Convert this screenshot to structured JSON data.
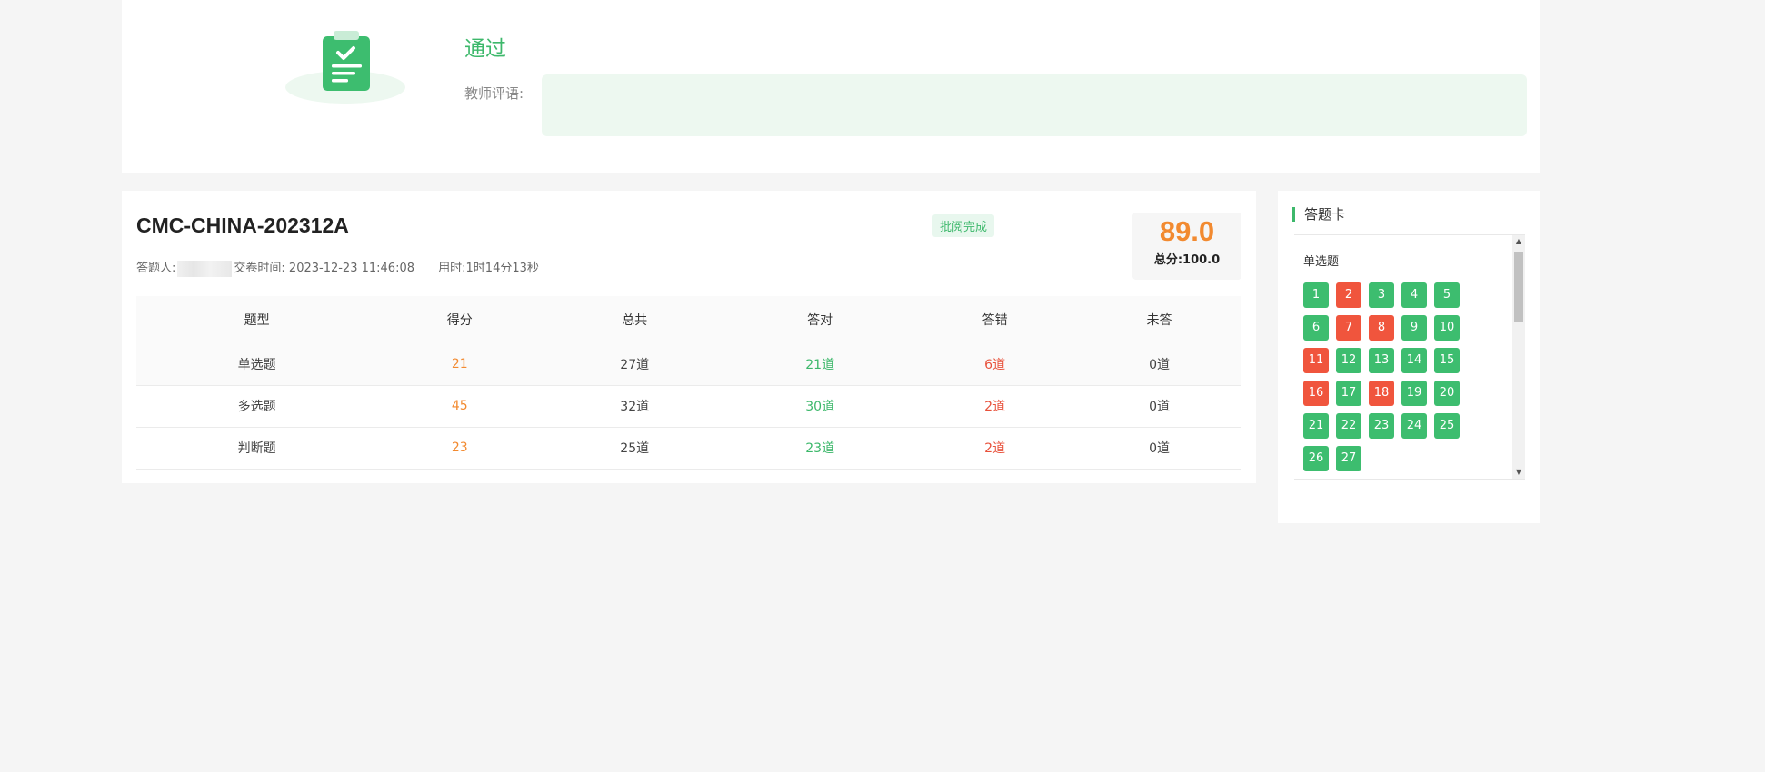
{
  "result": {
    "status_title": "通过",
    "comment_label": "教师评语:",
    "comment_text": ""
  },
  "exam": {
    "title": "CMC-CHINA-202312A",
    "status_badge": "批阅完成",
    "answerer_label": "答题人:",
    "submit_label": "交卷时间:",
    "submit_time": "2023-12-23 11:46:08",
    "duration_label": "用时:",
    "duration": "1时14分13秒",
    "score": "89.0",
    "total_label": "总分:100.0"
  },
  "table": {
    "headers": [
      "题型",
      "得分",
      "总共",
      "答对",
      "答错",
      "未答"
    ],
    "rows": [
      [
        "单选题",
        "21",
        "27道",
        "21道",
        "6道",
        "0道"
      ],
      [
        "多选题",
        "45",
        "32道",
        "30道",
        "2道",
        "0道"
      ],
      [
        "判断题",
        "23",
        "25道",
        "23道",
        "2道",
        "0道"
      ]
    ]
  },
  "answer_card": {
    "title": "答题卡",
    "section": "单选题",
    "questions": [
      {
        "n": "1",
        "s": "correct"
      },
      {
        "n": "2",
        "s": "wrong"
      },
      {
        "n": "3",
        "s": "correct"
      },
      {
        "n": "4",
        "s": "correct"
      },
      {
        "n": "5",
        "s": "correct"
      },
      {
        "n": "6",
        "s": "correct"
      },
      {
        "n": "7",
        "s": "wrong"
      },
      {
        "n": "8",
        "s": "wrong"
      },
      {
        "n": "9",
        "s": "correct"
      },
      {
        "n": "10",
        "s": "correct"
      },
      {
        "n": "11",
        "s": "wrong"
      },
      {
        "n": "12",
        "s": "correct"
      },
      {
        "n": "13",
        "s": "correct"
      },
      {
        "n": "14",
        "s": "correct"
      },
      {
        "n": "15",
        "s": "correct"
      },
      {
        "n": "16",
        "s": "wrong"
      },
      {
        "n": "17",
        "s": "correct"
      },
      {
        "n": "18",
        "s": "wrong"
      },
      {
        "n": "19",
        "s": "correct"
      },
      {
        "n": "20",
        "s": "correct"
      },
      {
        "n": "21",
        "s": "correct"
      },
      {
        "n": "22",
        "s": "correct"
      },
      {
        "n": "23",
        "s": "correct"
      },
      {
        "n": "24",
        "s": "correct"
      },
      {
        "n": "25",
        "s": "correct"
      },
      {
        "n": "26",
        "s": "correct"
      },
      {
        "n": "27",
        "s": "correct"
      }
    ]
  },
  "colors": {
    "green": "#3db86b",
    "orange": "#f28a30",
    "red": "#e8513b"
  },
  "icons": {
    "result": "clipboard-check-icon",
    "scroll_up": "triangle-up-icon",
    "scroll_down": "triangle-down-icon"
  }
}
